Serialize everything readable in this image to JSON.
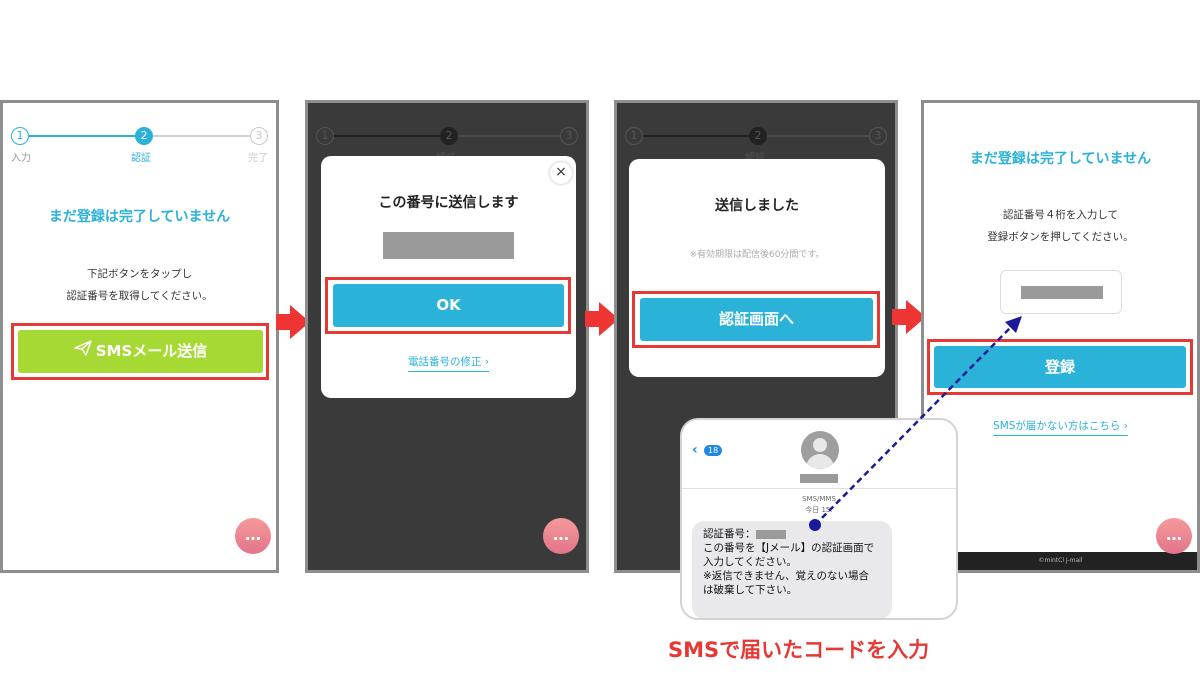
{
  "stepper": {
    "steps": [
      {
        "num": "1",
        "label": "入力"
      },
      {
        "num": "2",
        "label": "認証"
      },
      {
        "num": "3",
        "label": "完了"
      }
    ]
  },
  "screen1": {
    "headline": "まだ登録は完了していません",
    "instruction_line1": "下記ボタンをタップし",
    "instruction_line2": "認証番号を取得してください。",
    "send_button": "SMSメール送信",
    "send_icon": "paper-plane-icon"
  },
  "screen2": {
    "modal_title": "この番号に送信します",
    "ok_button": "OK",
    "edit_link": "電話番号の修正",
    "close_icon": "×"
  },
  "screen3": {
    "modal_title": "送信しました",
    "expiry_note": "※有効期限は配信後60分間です。",
    "goto_button": "認証画面へ"
  },
  "screen4": {
    "headline": "まだ登録は完了していません",
    "instruction_line1": "認証番号４桁を入力して",
    "instruction_line2": "登録ボタンを押してください。",
    "register_button": "登録",
    "no_sms_link": "SMSが届かない方はこちら",
    "footer": "©mintCl J-mail"
  },
  "sms": {
    "badge": "18",
    "type_label": "SMS/MMS",
    "date_label": "今日 15:",
    "lines": [
      "認証番号：",
      "この番号を【Jメール】の認証画面で",
      "入力してください。",
      "※返信できません、覚えのない場合",
      "は破棄して下さい。"
    ]
  },
  "caption": "SMSで届いたコードを入力",
  "colors": {
    "accent_blue": "#2bb2d9",
    "green": "#a6d934",
    "highlight_red": "#e53935",
    "dashed_arrow": "#1a1a9a"
  },
  "chat_icon": "…"
}
